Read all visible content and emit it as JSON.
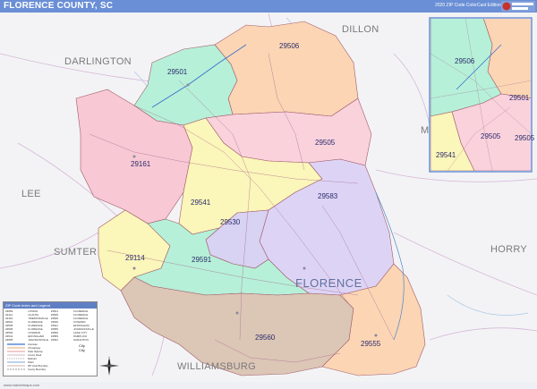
{
  "title": "FLORENCE COUNTY, SC",
  "edition": "2020 ZIP Code ColorCast Edition",
  "brand": {
    "name": "MARKET MAPS",
    "accent": "#c8312c"
  },
  "colors": {
    "title_bar": "#6a8fd6",
    "zip_29501": "#b6f0d8",
    "zip_29506": "#fbd5b4",
    "zip_29505": "#f9d2dc",
    "zip_29161": "#f8c8d4",
    "zip_29541": "#fbf6b9",
    "zip_29530": "#d8d2f3",
    "zip_29583": "#ddd4f5",
    "zip_29114": "#fbf6b9",
    "zip_29591": "#b6f0d8",
    "zip_29560": "#dcc6b6",
    "zip_29555": "#fbd5b4"
  },
  "county_labels": [
    "DILLON",
    "DARLINGTON",
    "LEE",
    "SUMTER",
    "HORRY",
    "WILLIAMSBURG"
  ],
  "city_labels": [
    "FLORENCE"
  ],
  "zip_labels": [
    "29506",
    "29501",
    "29505",
    "29161",
    "29541",
    "29583",
    "29530",
    "29114",
    "29591",
    "29560",
    "29555"
  ],
  "inset": {
    "zip_labels": [
      "29506",
      "29501",
      "29505",
      "29505",
      "29541"
    ],
    "partial_label": "M"
  },
  "legend": {
    "header": "ZIP Code Index and Legend",
    "rows": [
      [
        "29069",
        "HYMAN",
        "29501",
        "FLORENCE"
      ],
      [
        "29114",
        "OLANTA",
        "29505",
        "FLORENCE"
      ],
      [
        "29161",
        "TIMMONSVILLE",
        "29506",
        "FLORENCE"
      ],
      [
        "29501",
        "FLORENCE",
        "29530",
        "COWARD"
      ],
      [
        "29505",
        "FLORENCE",
        "29541",
        "EFFINGHAM"
      ],
      [
        "29506",
        "FLORENCE",
        "29555",
        "JOHNSONVILLE"
      ],
      [
        "29530",
        "COWARD",
        "29560",
        "LAKE CITY"
      ],
      [
        "29541",
        "EFFINGHAM",
        "29583",
        "PAMPLICO"
      ],
      [
        "29555",
        "JOHNSONVILLE",
        "29591",
        "SCRANTON"
      ]
    ],
    "icons": [
      "City",
      "City"
    ],
    "line_labels": [
      "Interstate",
      "US Highway",
      "State Highway",
      "County Road",
      "Railroad",
      "Water",
      "ZIP Code Boundary",
      "County Boundary"
    ]
  },
  "compass_letters": [
    "N",
    "S",
    "E",
    "W"
  ],
  "footer": "www.marketmaps.com"
}
